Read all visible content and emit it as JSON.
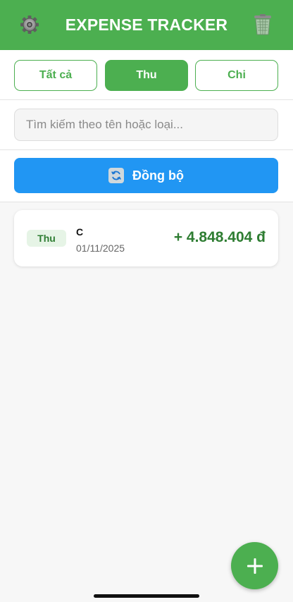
{
  "header": {
    "title": "EXPENSE TRACKER",
    "settings_icon": "gear-icon",
    "delete_icon": "trash-icon",
    "color": "#4caf50"
  },
  "filters": {
    "tabs": [
      {
        "label": "Tất cả",
        "active": false
      },
      {
        "label": "Thu",
        "active": true
      },
      {
        "label": "Chi",
        "active": false
      }
    ]
  },
  "search": {
    "placeholder": "Tìm kiếm theo tên hoặc loại...",
    "value": ""
  },
  "sync": {
    "label": "Đồng bộ",
    "icon": "refresh-icon",
    "color": "#2196f3"
  },
  "transactions": [
    {
      "type": "Thu",
      "name": "C",
      "date": "01/11/2025",
      "amount": "+ 4.848.404 đ"
    }
  ],
  "fab": {
    "icon": "plus-icon"
  }
}
